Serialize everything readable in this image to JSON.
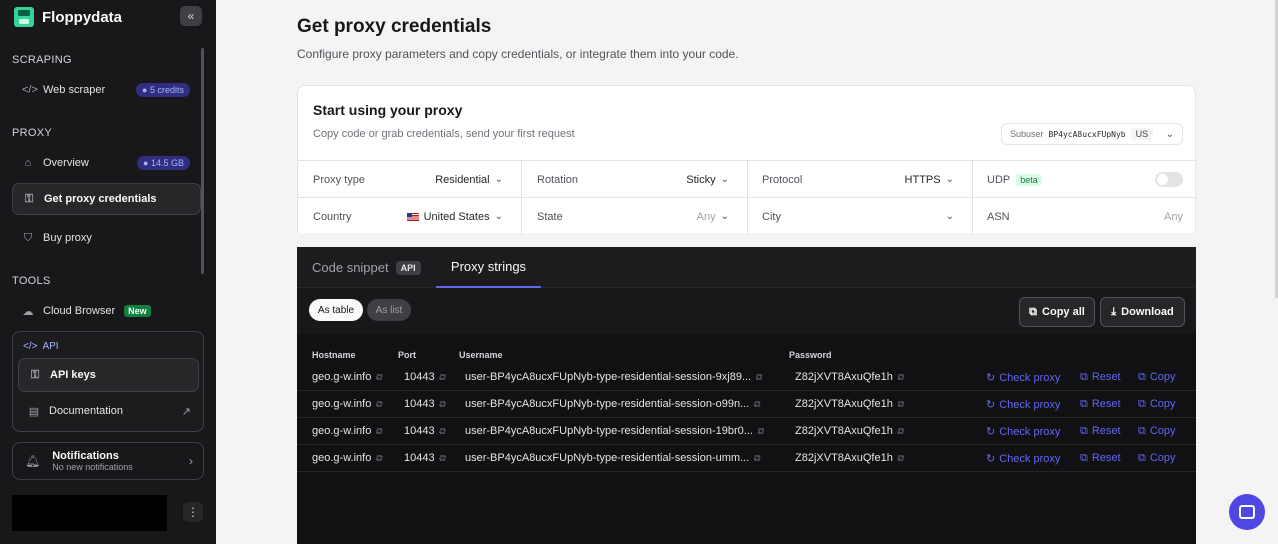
{
  "app": {
    "name": "Floppydata",
    "collapse_icon": "«"
  },
  "sidebar": {
    "scraping_title": "SCRAPING",
    "web_scraper": {
      "label": "Web scraper",
      "badge": "5 credits"
    },
    "proxy_title": "PROXY",
    "overview": {
      "label": "Overview",
      "badge": "14.5 GB"
    },
    "get_credentials": {
      "label": "Get proxy credentials"
    },
    "buy_proxy": {
      "label": "Buy proxy"
    },
    "tools_title": "TOOLS",
    "cloud_browser": {
      "label": "Cloud Browser",
      "badge": "New"
    },
    "api_section": {
      "title": "API",
      "api_keys": "API keys",
      "documentation": "Documentation"
    },
    "notifications": {
      "title": "Notifications",
      "subtitle": "No new notifications"
    }
  },
  "main": {
    "title": "Get proxy credentials",
    "subtitle": "Configure proxy parameters and copy credentials, or integrate them into your code."
  },
  "card": {
    "title": "Start using your proxy",
    "subtitle": "Copy code or grab credentials, send your first request",
    "subuser": {
      "label": "Subuser",
      "id": "BP4ycA8ucxFUpNyb",
      "country": "US"
    },
    "fields": {
      "proxy_type": {
        "label": "Proxy type",
        "value": "Residential"
      },
      "rotation": {
        "label": "Rotation",
        "value": "Sticky"
      },
      "protocol": {
        "label": "Protocol",
        "value": "HTTPS"
      },
      "udp": {
        "label": "UDP",
        "badge": "beta",
        "enabled": false
      },
      "country": {
        "label": "Country",
        "value": "United States"
      },
      "state": {
        "label": "State",
        "value": "Any"
      },
      "city": {
        "label": "City",
        "value": ""
      },
      "asn": {
        "label": "ASN",
        "value": "Any"
      }
    }
  },
  "panel": {
    "tabs": {
      "code_snippet": "Code snippet",
      "api_tag": "API",
      "proxy_strings": "Proxy strings"
    },
    "view": {
      "as_table": "As table",
      "as_list": "As list"
    },
    "copy_all": "Copy all",
    "download": "Download",
    "columns": {
      "hostname": "Hostname",
      "port": "Port",
      "username": "Username",
      "password": "Password"
    },
    "actions": {
      "check": "Check proxy",
      "reset": "Reset",
      "copy": "Copy"
    },
    "rows": [
      {
        "host": "geo.g-w.info",
        "port": "10443",
        "user": "user-BP4ycA8ucxFUpNyb-type-residential-session-9xj89...",
        "pass": "Z82jXVT8AxuQfe1h"
      },
      {
        "host": "geo.g-w.info",
        "port": "10443",
        "user": "user-BP4ycA8ucxFUpNyb-type-residential-session-o99n...",
        "pass": "Z82jXVT8AxuQfe1h"
      },
      {
        "host": "geo.g-w.info",
        "port": "10443",
        "user": "user-BP4ycA8ucxFUpNyb-type-residential-session-19br0...",
        "pass": "Z82jXVT8AxuQfe1h"
      },
      {
        "host": "geo.g-w.info",
        "port": "10443",
        "user": "user-BP4ycA8ucxFUpNyb-type-residential-session-umm...",
        "pass": "Z82jXVT8AxuQfe1h"
      }
    ]
  },
  "colors": {
    "accent": "#6366f1",
    "sidebar_bg": "#18181b",
    "brand": "#34d399"
  }
}
